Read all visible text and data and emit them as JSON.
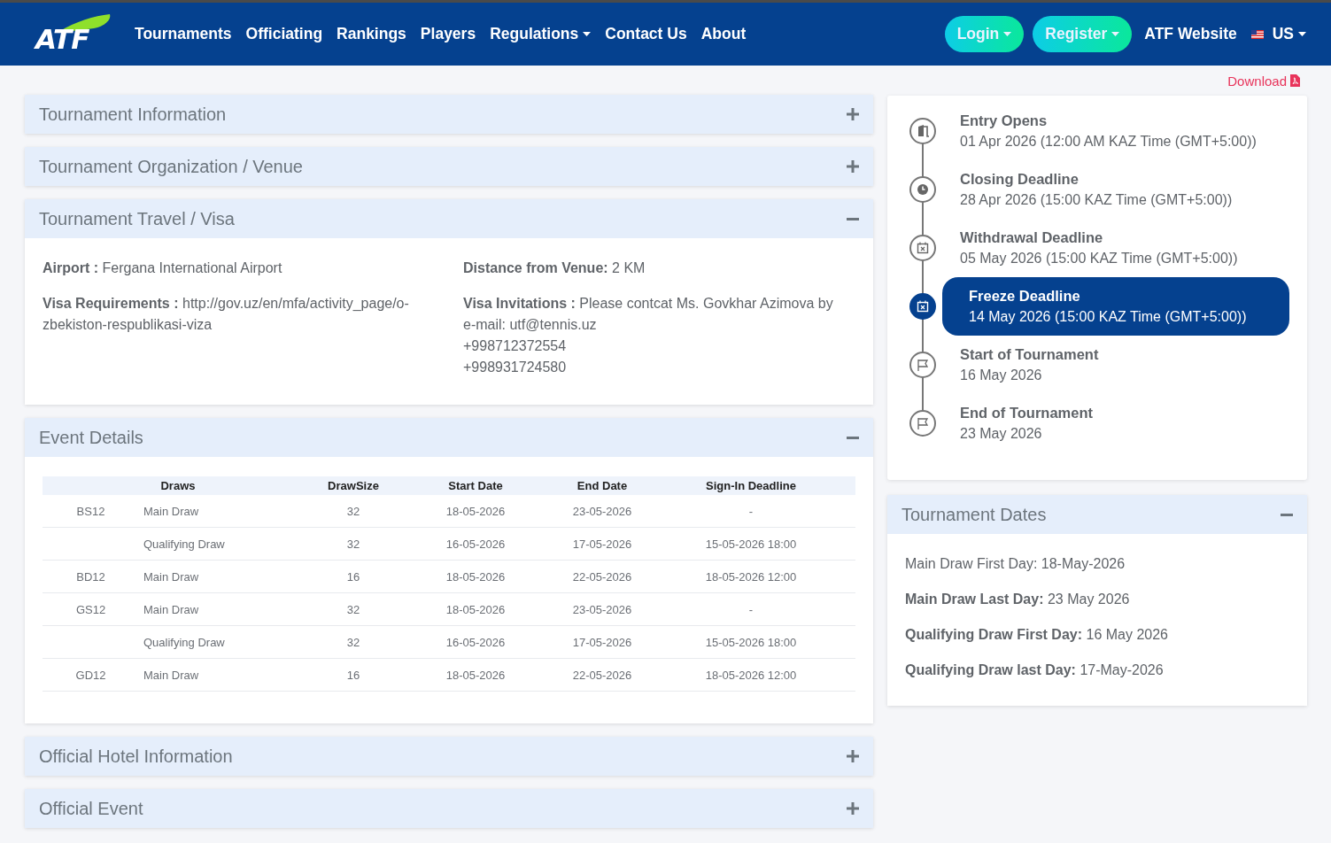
{
  "header": {
    "logo": "ATF",
    "nav": [
      {
        "label": "Tournaments",
        "dropdown": false
      },
      {
        "label": "Officiating",
        "dropdown": false
      },
      {
        "label": "Rankings",
        "dropdown": false
      },
      {
        "label": "Players",
        "dropdown": false
      },
      {
        "label": "Regulations",
        "dropdown": true
      },
      {
        "label": "Contact Us",
        "dropdown": false
      },
      {
        "label": "About",
        "dropdown": false
      }
    ],
    "login": "Login",
    "register": "Register",
    "website": "ATF Website",
    "language": "US"
  },
  "sections_top": [
    {
      "title": "Tournament Information",
      "expanded": false
    },
    {
      "title": "Tournament Organization / Venue",
      "expanded": false
    }
  ],
  "travel": {
    "title": "Tournament Travel / Visa",
    "expanded": true,
    "left": [
      {
        "label": "Airport :",
        "value": "Fergana International Airport"
      },
      {
        "label": "Visa Requirements :",
        "value": "http://gov.uz/en/mfa/activity_page/o-zbekiston-respublikasi-viza"
      }
    ],
    "right": [
      {
        "label": "Distance from Venue:",
        "value": "2 KM"
      },
      {
        "label": "Visa Invitations :",
        "value": "Please contcat Ms. Govkhar Azimova by e-mail: utf@tennis.uz",
        "extra": [
          "+998712372554",
          "+998931724580"
        ]
      }
    ]
  },
  "events": {
    "title": "Event Details",
    "expanded": true,
    "columns": [
      "Draws",
      "DrawSize",
      "Start Date",
      "End Date",
      "Sign-In Deadline"
    ],
    "rows": [
      {
        "event": "BS12",
        "draw": "Main Draw",
        "size": "32",
        "start": "18-05-2026",
        "end": "23-05-2026",
        "deadline": "-"
      },
      {
        "draw": "Qualifying Draw",
        "size": "32",
        "start": "16-05-2026",
        "end": "17-05-2026",
        "deadline": "15-05-2026 18:00"
      },
      {
        "event": "BD12",
        "draw": "Main Draw",
        "size": "16",
        "start": "18-05-2026",
        "end": "22-05-2026",
        "deadline": "18-05-2026 12:00"
      },
      {
        "event": "GS12",
        "draw": "Main Draw",
        "size": "32",
        "start": "18-05-2026",
        "end": "23-05-2026",
        "deadline": "-"
      },
      {
        "draw": "Qualifying Draw",
        "size": "32",
        "start": "16-05-2026",
        "end": "17-05-2026",
        "deadline": "15-05-2026 18:00"
      },
      {
        "event": "GD12",
        "draw": "Main Draw",
        "size": "16",
        "start": "18-05-2026",
        "end": "22-05-2026",
        "deadline": "18-05-2026 12:00"
      }
    ]
  },
  "sections_bottom": [
    {
      "title": "Official Hotel Information",
      "expanded": false
    },
    {
      "title": "Official Event",
      "expanded": false
    }
  ],
  "download": "Download",
  "timeline": [
    {
      "title": "Entry Opens",
      "date": "01 Apr 2026 (12:00 AM KAZ Time (GMT+5:00))",
      "selected": false
    },
    {
      "title": "Closing Deadline",
      "date": "28 Apr 2026 (15:00 KAZ Time (GMT+5:00))",
      "selected": false
    },
    {
      "title": "Withdrawal Deadline",
      "date": "05 May 2026 (15:00 KAZ Time (GMT+5:00))",
      "selected": false
    },
    {
      "title": "Freeze Deadline",
      "date": "14 May 2026 (15:00 KAZ Time (GMT+5:00))",
      "selected": true
    },
    {
      "title": "Start of Tournament",
      "date": "16 May 2026",
      "selected": false
    },
    {
      "title": "End of Tournament",
      "date": "23 May 2026",
      "selected": false
    }
  ],
  "dates": {
    "title": "Tournament Dates",
    "expanded": true,
    "items": [
      {
        "label": "Main Draw First Day:",
        "value": "18-May-2026",
        "bold": false
      },
      {
        "label": "Main Draw Last Day:",
        "value": "23 May 2026",
        "bold": true
      },
      {
        "label": "Qualifying Draw First Day:",
        "value": "16 May 2026",
        "bold": true
      },
      {
        "label": "Qualifying Draw last Day:",
        "value": "17-May-2026",
        "bold": true
      }
    ]
  }
}
